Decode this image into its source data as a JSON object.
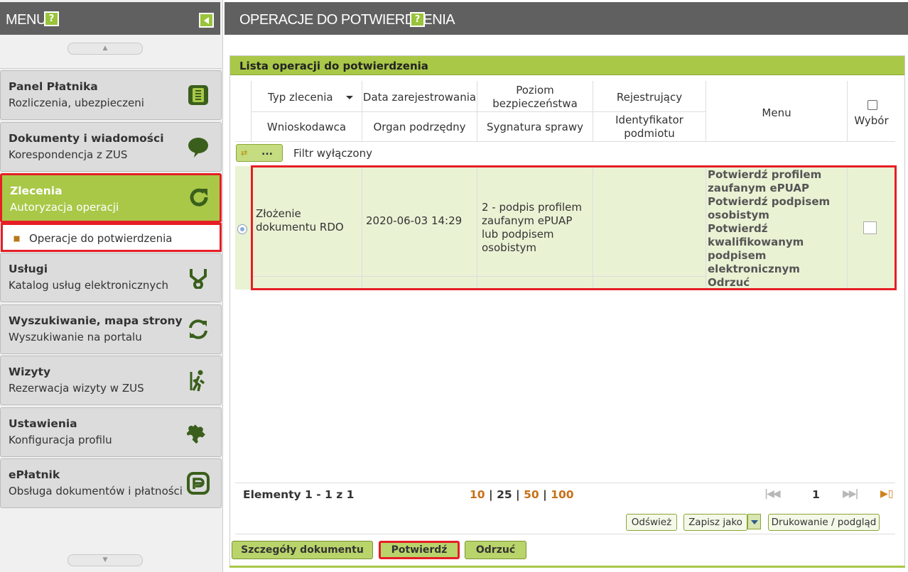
{
  "sidebar": {
    "title": "MENU",
    "help_label": "?",
    "items": [
      {
        "title": "Panel Płatnika",
        "subtitle": "Rozliczenia, ubezpieczeni",
        "icon": "ledger-icon"
      },
      {
        "title": "Dokumenty i wiadomości",
        "subtitle": "Korespondencja z ZUS",
        "icon": "speech-bubble-icon"
      },
      {
        "title": "Zlecenia",
        "subtitle": "Autoryzacja operacji",
        "icon": "refresh-arrow-icon"
      },
      {
        "title": "Usługi",
        "subtitle": "Katalog usług elektronicznych",
        "icon": "branch-icon"
      },
      {
        "title": "Wyszukiwanie, mapa strony",
        "subtitle": "Wyszukiwanie na portalu",
        "icon": "sync-icon"
      },
      {
        "title": "Wizyty",
        "subtitle": "Rezerwacja wizyty w ZUS",
        "icon": "walking-person-icon"
      },
      {
        "title": "Ustawienia",
        "subtitle": "Konfiguracja profilu",
        "icon": "puzzle-icon"
      },
      {
        "title": "ePłatnik",
        "subtitle": "Obsługa dokumentów i płatności",
        "icon": "eplatnik-logo-icon"
      }
    ],
    "active_sub": "Operacje do potwierdzenia",
    "scroll_up": "▲",
    "scroll_down": "▼"
  },
  "main": {
    "title": "OPERACJE DO POTWIERDZENIA",
    "help_label": "?",
    "panel_title": "Lista operacji do potwierdzenia",
    "columns_top": [
      "Typ zlecenia",
      "Data zarejestrowania",
      "Poziom bezpieczeństwa",
      "Rejestrujący"
    ],
    "columns_bottom": [
      "Wnioskodawca",
      "Organ podrzędny",
      "Sygnatura sprawy",
      "Identyfikator podmiotu"
    ],
    "col_menu": "Menu",
    "col_select": "Wybór",
    "filter_button": "...",
    "filter_status": "Filtr wyłączony",
    "row": {
      "type": "Złożenie dokumentu RDO",
      "date": "2020-06-03 14:29",
      "security": "2 - podpis profilem zaufanym ePUAP lub podpisem osobistym",
      "registrant": "",
      "menu": [
        "Potwierdź profilem zaufanym ePUAP",
        "Potwierdź podpisem osobistym",
        "Potwierdź kwalifikowanym podpisem elektronicznym",
        "Odrzuć"
      ]
    },
    "pagination": {
      "elements": "Elementy 1 - 1 z 1",
      "sizes": [
        "10",
        "25",
        "50",
        "100"
      ],
      "current_size": "25",
      "separator": "|",
      "page": "1"
    },
    "toolbar": {
      "refresh": "Odśwież",
      "save_as": "Zapisz jako",
      "print": "Drukowanie / podgląd"
    },
    "actions": {
      "details": "Szczegóły dokumentu",
      "confirm": "Potwierdź",
      "reject": "Odrzuć"
    },
    "colors": {
      "header_gray": "#606060",
      "accent_green": "#a9c848",
      "highlight_red": "#e61e25",
      "link_orange": "#c87018"
    }
  }
}
